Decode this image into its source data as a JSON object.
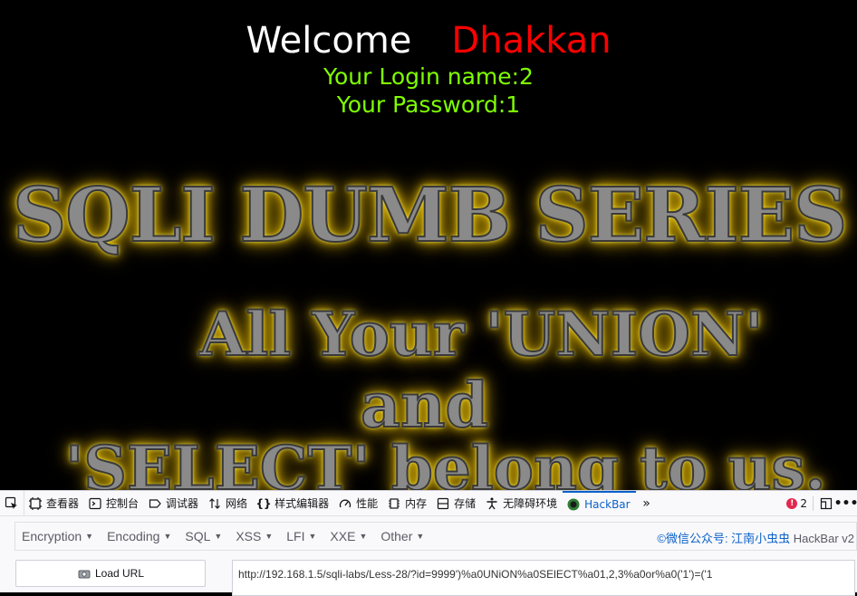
{
  "page": {
    "welcome": "Welcome",
    "name": "Dhakkan",
    "login_line": "Your Login name:2",
    "password_line": "Your Password:1",
    "banner_title": "SQLI DUMB SERIES",
    "banner_union": "All Your 'UNION'",
    "banner_and": "and",
    "banner_select": "'SELECT' belong to us."
  },
  "devtools": {
    "tabs": [
      {
        "label": "查看器",
        "icon": "inspector-icon"
      },
      {
        "label": "控制台",
        "icon": "console-icon"
      },
      {
        "label": "调试器",
        "icon": "debugger-icon"
      },
      {
        "label": "网络",
        "icon": "network-icon"
      },
      {
        "label": "样式编辑器",
        "icon": "style-editor-icon"
      },
      {
        "label": "性能",
        "icon": "performance-icon"
      },
      {
        "label": "内存",
        "icon": "memory-icon"
      },
      {
        "label": "存储",
        "icon": "storage-icon"
      },
      {
        "label": "无障碍环境",
        "icon": "accessibility-icon"
      },
      {
        "label": "HackBar",
        "icon": "hackbar-icon"
      }
    ],
    "error_count": "2",
    "active_color": "#0b61c9"
  },
  "hackbar": {
    "menu": [
      "Encryption",
      "Encoding",
      "SQL",
      "XSS",
      "LFI",
      "XXE",
      "Other"
    ],
    "brand": "©微信公众号: 江南小虫虫",
    "version": "HackBar v2",
    "load_url": "Load URL",
    "url": "http://192.168.1.5/sqli-labs/Less-28/?id=9999')%a0UNiON%a0SElECT%a01,2,3%a0or%a0('1')=('1"
  }
}
